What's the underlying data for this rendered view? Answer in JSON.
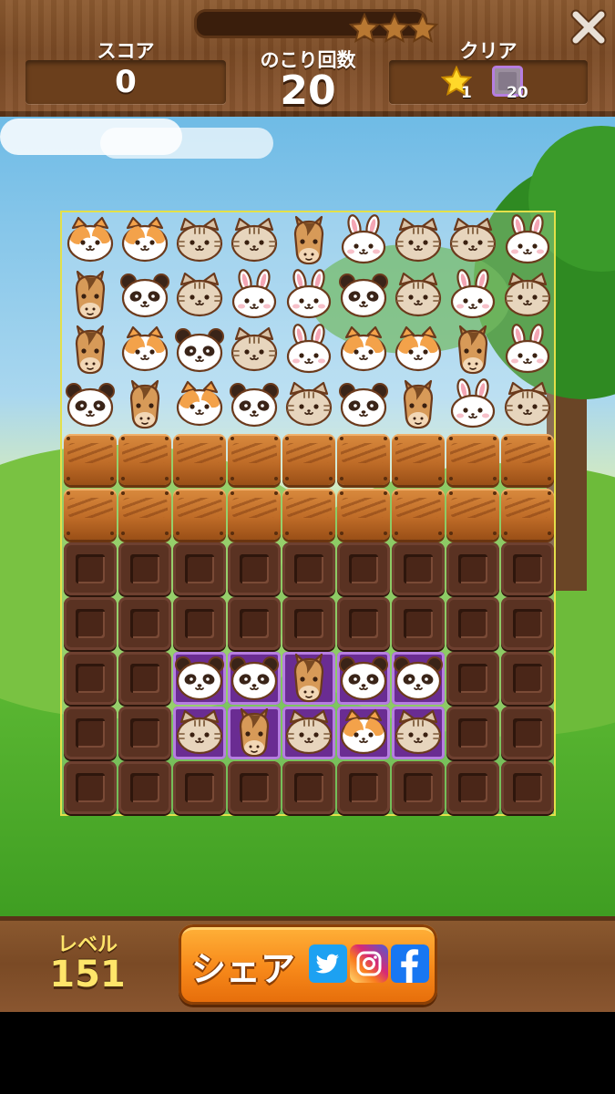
{
  "header": {
    "score_label": "スコア",
    "score_value": "0",
    "moves_label": "のこり回数",
    "moves_value": "20",
    "goal_label": "クリア",
    "goals": [
      {
        "icon": "star-icon",
        "count": "1"
      },
      {
        "icon": "stone-block-icon",
        "count": "20"
      }
    ],
    "stars_earned": 0,
    "progress": 0
  },
  "board": {
    "columns": 9,
    "rows": 11,
    "legend": {
      "C": "calico-cat",
      "T": "tabby-cat",
      "H": "horse",
      "R": "rabbit",
      "P": "panda",
      "W": "wood-crate",
      "S": "chocolate-block",
      "p": "on-purple-tile"
    },
    "grid": [
      [
        "C",
        "C",
        "T",
        "T",
        "H",
        "R",
        "T",
        "T",
        "R"
      ],
      [
        "H",
        "P",
        "T",
        "R",
        "R",
        "P",
        "T",
        "R",
        "T"
      ],
      [
        "H",
        "C",
        "P",
        "T",
        "R",
        "C",
        "C",
        "H",
        "R"
      ],
      [
        "P",
        "H",
        "C",
        "P",
        "T",
        "P",
        "H",
        "R",
        "T"
      ],
      [
        "W",
        "W",
        "W",
        "W",
        "W",
        "W",
        "W",
        "W",
        "W"
      ],
      [
        "W",
        "W",
        "W",
        "W",
        "W",
        "W",
        "W",
        "W",
        "W"
      ],
      [
        "S",
        "S",
        "S",
        "S",
        "S",
        "S",
        "S",
        "S",
        "S"
      ],
      [
        "S",
        "S",
        "S",
        "S",
        "S",
        "S",
        "S",
        "S",
        "S"
      ],
      [
        "S",
        "S",
        "pP",
        "pP",
        "pH",
        "pP",
        "pP",
        "S",
        "S"
      ],
      [
        "S",
        "S",
        "pT",
        "pH",
        "pT",
        "pC",
        "pT",
        "S",
        "S"
      ],
      [
        "S",
        "S",
        "S",
        "S",
        "S",
        "S",
        "S",
        "S",
        "S"
      ]
    ]
  },
  "footer": {
    "level_label": "レベル",
    "level_value": "151",
    "share_label": "シェア",
    "share_icons": [
      "twitter-icon",
      "instagram-icon",
      "facebook-icon"
    ]
  },
  "colors": {
    "wood": "#7a4a25",
    "text_yellow": "#ffe56a",
    "share_orange": "#f7891a",
    "board_border": "#e4e04a",
    "twitter": "#1da1f2",
    "facebook": "#1877f2"
  }
}
